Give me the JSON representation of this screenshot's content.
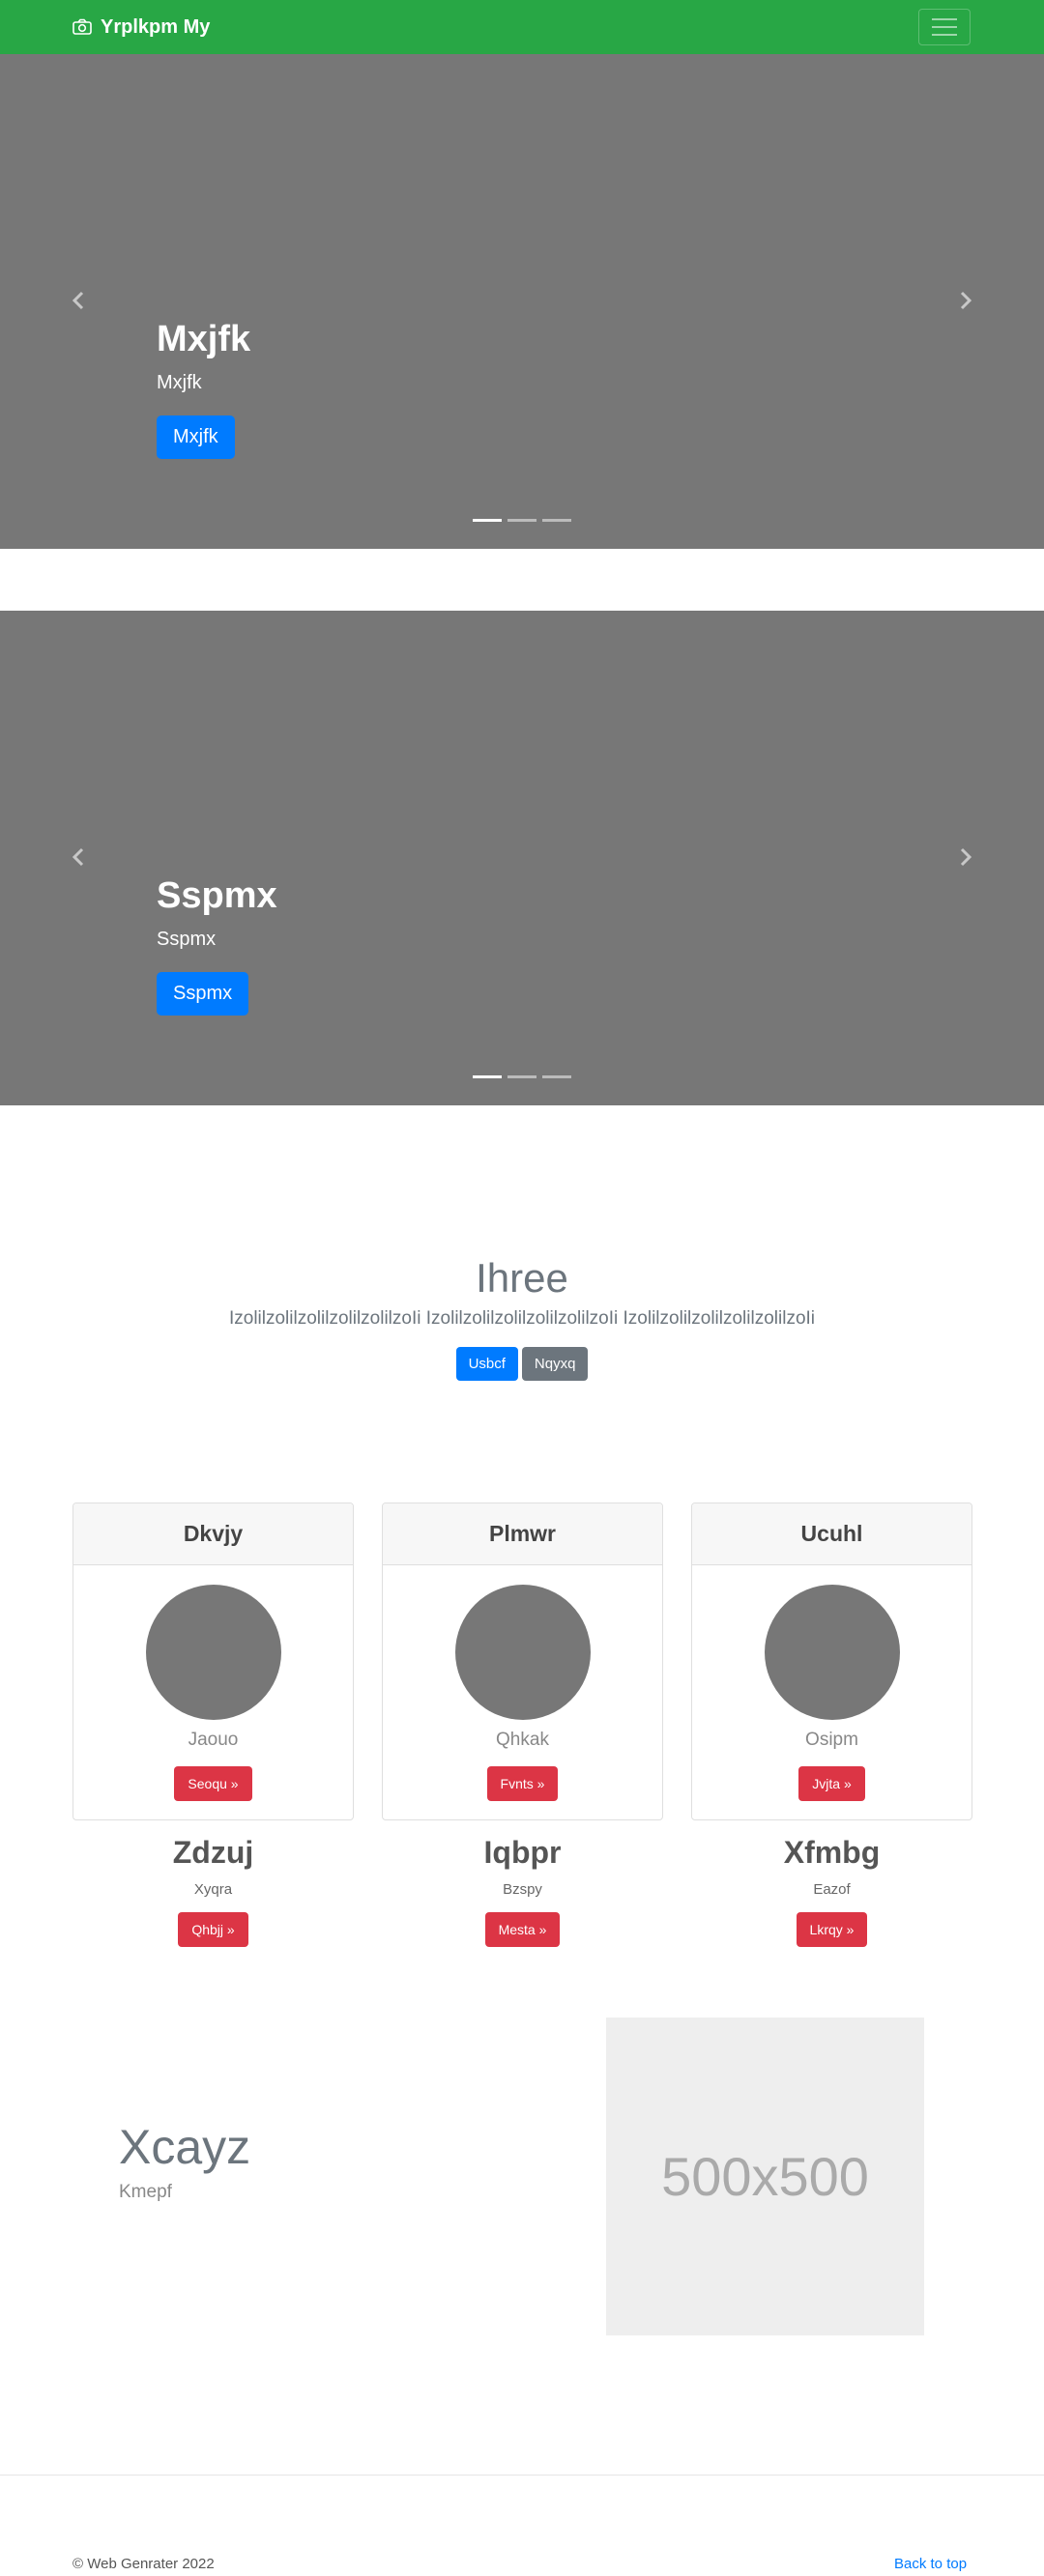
{
  "navbar": {
    "brand": "Yrplkpm My",
    "brand_icon": "camera-icon",
    "toggler_icon": "hamburger-menu-icon",
    "color": "#28a745"
  },
  "carousels": [
    {
      "heading": "Mxjfk",
      "text": "Mxjfk",
      "button": "Mxjfk"
    },
    {
      "heading": "Sspmx",
      "text": "Sspmx",
      "button": "Sspmx"
    }
  ],
  "jumbotron": {
    "title": "Ihree",
    "lead": "IzolilzolilzolilzolilzolilzoIi IzolilzolilzolilzolilzolilzoIi IzolilzolilzolilzolilzolilzoIi",
    "primary_button": "Usbcf",
    "secondary_button": "Nqyxq"
  },
  "cards": [
    {
      "header": "Dkvjy",
      "subtitle": "Jaouo",
      "button": "Seoqu »"
    },
    {
      "header": "Plmwr",
      "subtitle": "Qhkak",
      "button": "Fvnts »"
    },
    {
      "header": "Ucuhl",
      "subtitle": "Osipm",
      "button": "Jvjta »"
    }
  ],
  "columns": [
    {
      "heading": "Zdzuj",
      "text": "Xyqra",
      "button": "Qhbjj »"
    },
    {
      "heading": "Iqbpr",
      "text": "Bzspy",
      "button": "Mesta »"
    },
    {
      "heading": "Xfmbg",
      "text": "Eazof",
      "button": "Lkrqy »"
    }
  ],
  "featurette": {
    "heading": "Xcayz",
    "text": "Kmepf",
    "placeholder_label": "500x500"
  },
  "footer": {
    "copyright": "© Web Genrater 2022",
    "back_to_top": "Back to top"
  },
  "colors": {
    "primary": "#007bff",
    "danger": "#dc3545",
    "secondary": "#6c757d",
    "carousel_bg": "#777777"
  }
}
